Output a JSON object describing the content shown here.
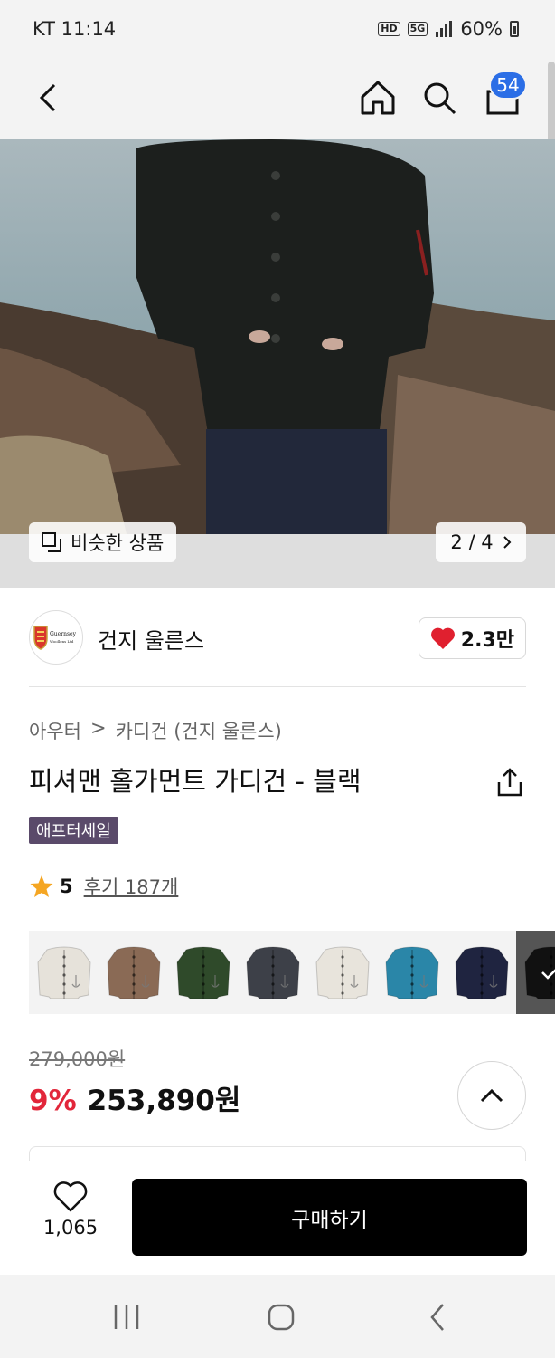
{
  "status_bar": {
    "carrier_time": "KT 11:14",
    "hd_label": "HD",
    "network_label": "5G",
    "battery": "60%"
  },
  "nav": {
    "cart_count": "54",
    "icons": [
      "back-arrow-icon",
      "home-icon",
      "search-icon",
      "cart-bag-icon"
    ]
  },
  "hero": {
    "similar_label": "비슷한 상품",
    "pager": "2 / 4"
  },
  "brand": {
    "name": "건지 울른스",
    "logo_text_1": "Guernsey",
    "logo_text_2": "Woollens Ltd",
    "likes": "2.3만"
  },
  "breadcrumb": {
    "category": "아우터",
    "subcategory": "카디건 (건지 울른스)"
  },
  "product": {
    "title": "피셔맨 홀가먼트 가디건 - 블랙",
    "badge": "애프터세일",
    "rating": "5",
    "reviews": "후기 187개"
  },
  "swatches": [
    {
      "color": "#e6e2da"
    },
    {
      "color": "#8a6a55"
    },
    {
      "color": "#2f4a2a"
    },
    {
      "color": "#3d4048"
    },
    {
      "color": "#e8e4dc"
    },
    {
      "color": "#2a86a8"
    },
    {
      "color": "#1f2440"
    },
    {
      "color": "#111111",
      "selected": true
    }
  ],
  "price": {
    "original": "279,000원",
    "discount": "9%",
    "sale": "253,890원"
  },
  "bottom": {
    "wish_count": "1,065",
    "buy_label": "구매하기"
  },
  "colors": {
    "accent_blue": "#2b6ee6",
    "discount_red": "#e2263a",
    "badge_purple": "#5a4a6a",
    "heart_red": "#e0202f",
    "star": "#f5a623"
  }
}
